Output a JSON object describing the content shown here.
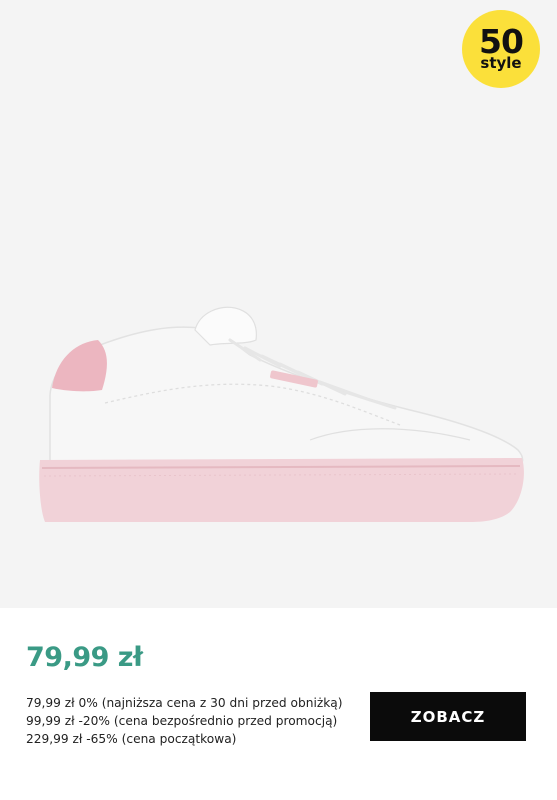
{
  "badge": {
    "number": "50",
    "word": "style",
    "color": "#fbe03a"
  },
  "product": {
    "image_alt": "white sneaker with pink sole",
    "price": "79,99 zł",
    "price_color": "#3a9a85",
    "price_history": [
      "79,99 zł 0% (najniższa cena z 30 dni przed obniżką)",
      "99,99 zł -20% (cena bezpośrednio przed promocją)",
      "229,99 zł -65% (cena początkowa)"
    ]
  },
  "cta": {
    "label": "ZOBACZ"
  }
}
